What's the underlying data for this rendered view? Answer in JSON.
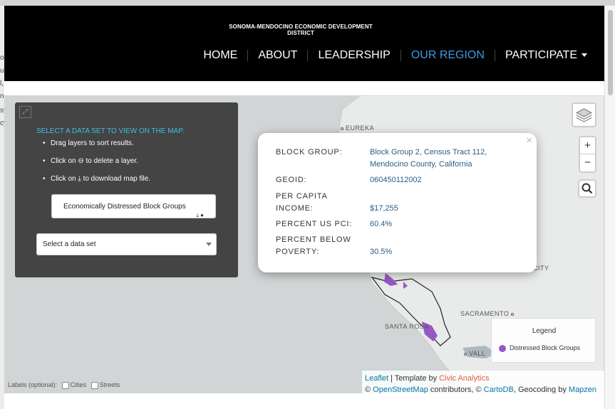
{
  "header": {
    "brand": "SONOMA-MENDOCINO ECONOMIC DEVELOPMENT DISTRICT",
    "nav": [
      {
        "label": "HOME"
      },
      {
        "label": "ABOUT"
      },
      {
        "label": "LEADERSHIP"
      },
      {
        "label": "OUR REGION",
        "active": true
      },
      {
        "label": "PARTICIPATE"
      }
    ],
    "active_color": "#3b9be0"
  },
  "panel": {
    "heading": "SELECT A DATA SET TO VIEW ON THE MAP.",
    "tip1": "Drag layers to sort results.",
    "tip2_prefix": "Click on",
    "tip2_suffix": "to delete a layer.",
    "tip3_prefix": "Click on",
    "tip3_suffix": "to download map file.",
    "layer_item": "Economically Distressed Block Groups",
    "select_label": "Select a data set",
    "heading_color": "#3fbfe8"
  },
  "popup": {
    "close": "×",
    "fields": [
      {
        "label": "BLOCK GROUP:",
        "value_line1": "Block Group 2, Census Tract 112,",
        "value_line2": "Mendocino County, California"
      },
      {
        "label": "GEOID:",
        "value": "060450112002"
      },
      {
        "label_line1": "PER CAPITA",
        "label_line2": "INCOME:",
        "value": "$17,255"
      },
      {
        "label": "PERCENT US PCI:",
        "value": "60.4%"
      },
      {
        "label_line1": "PERCENT BELOW",
        "label_line2": "POVERTY:",
        "value": "30.5%"
      }
    ]
  },
  "map_controls": {
    "zoom_in": "+",
    "zoom_out": "−"
  },
  "places": {
    "eureka": "EUREKA",
    "city": "CITY",
    "sacramento": "SACRAMENTO",
    "santa_rosa": "SANTA ROSA",
    "vallejo": "VALL"
  },
  "legend": {
    "title": "Legend",
    "entry": "Distressed Block Groups",
    "color": "#9559c7"
  },
  "attribution": {
    "leaflet": "Leaflet",
    "template_by": "| Template by",
    "civic": "Civic Analytics",
    "osm": "OpenStreetMap",
    "contributors": "contributors, ©",
    "carto": "CartoDB",
    "geocoding": ", Geocoding by",
    "mapzen": "Mapzen",
    "copyright": "©"
  },
  "labels_toggle": {
    "label": "Labels (optional):",
    "cities": "Cities",
    "streets": "Streets"
  },
  "edge_fragments": [
    "oh",
    "u",
    "l,",
    "n",
    "sy",
    "cy"
  ]
}
